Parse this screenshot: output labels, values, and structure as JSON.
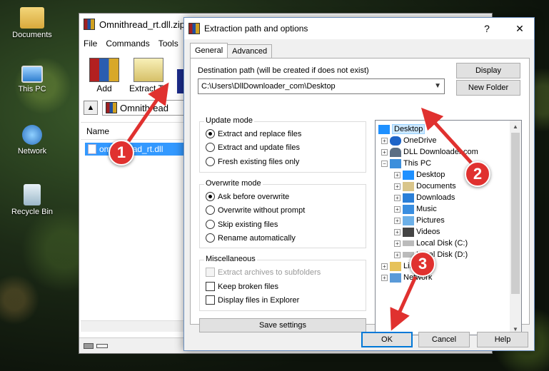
{
  "desktop": {
    "icons": [
      {
        "label": "Documents",
        "icon": "documents-folder-icon"
      },
      {
        "label": "This PC",
        "icon": "computer-icon"
      },
      {
        "label": "Network",
        "icon": "network-icon"
      },
      {
        "label": "Recycle Bin",
        "icon": "recycle-bin-icon"
      }
    ]
  },
  "winrar": {
    "title": "Omnithread_rt.dll.zip",
    "menu": [
      "File",
      "Commands",
      "Tools"
    ],
    "toolbar": [
      {
        "label": "Add"
      },
      {
        "label": "Extract To"
      }
    ],
    "path": "Omnithread",
    "column_name": "Name",
    "file": "omnithread_rt.dll"
  },
  "dialog": {
    "title": "Extraction path and options",
    "help_glyph": "?",
    "close_glyph": "✕",
    "tabs": [
      "General",
      "Advanced"
    ],
    "dest_label": "Destination path (will be created if does not exist)",
    "dest_value": "C:\\Users\\DllDownloader_com\\Desktop",
    "display_button": "Display",
    "new_folder_button": "New Folder",
    "update_mode": {
      "title": "Update mode",
      "options": [
        "Extract and replace files",
        "Extract and update files",
        "Fresh existing files only"
      ],
      "selected": 0
    },
    "overwrite_mode": {
      "title": "Overwrite mode",
      "options": [
        "Ask before overwrite",
        "Overwrite without prompt",
        "Skip existing files",
        "Rename automatically"
      ],
      "selected": 0
    },
    "misc": {
      "title": "Miscellaneous",
      "options": [
        {
          "label": "Extract archives to subfolders",
          "checked": false,
          "disabled": true
        },
        {
          "label": "Keep broken files",
          "checked": false,
          "disabled": false
        },
        {
          "label": "Display files in Explorer",
          "checked": false,
          "disabled": false
        }
      ]
    },
    "save_settings": "Save settings",
    "tree": [
      {
        "label": "Desktop",
        "selected": true
      },
      {
        "label": "OneDrive",
        "selected": false
      },
      {
        "label": "DLL Downloader.com",
        "selected": false
      },
      {
        "label": "This PC",
        "selected": false
      },
      {
        "label": "Desktop",
        "selected": false
      },
      {
        "label": "Documents",
        "selected": false
      },
      {
        "label": "Downloads",
        "selected": false
      },
      {
        "label": "Music",
        "selected": false
      },
      {
        "label": "Pictures",
        "selected": false
      },
      {
        "label": "Videos",
        "selected": false
      },
      {
        "label": "Local Disk (C:)",
        "selected": false
      },
      {
        "label": "Local Disk (D:)",
        "selected": false
      },
      {
        "label": "Libraries",
        "selected": false
      },
      {
        "label": "Network",
        "selected": false
      }
    ],
    "ok": "OK",
    "cancel": "Cancel",
    "help": "Help"
  },
  "callouts": [
    "1",
    "2",
    "3"
  ],
  "colors": {
    "callout": "#e0312f",
    "selection": "#3399ff",
    "tree_selection": "#cce8ff"
  }
}
